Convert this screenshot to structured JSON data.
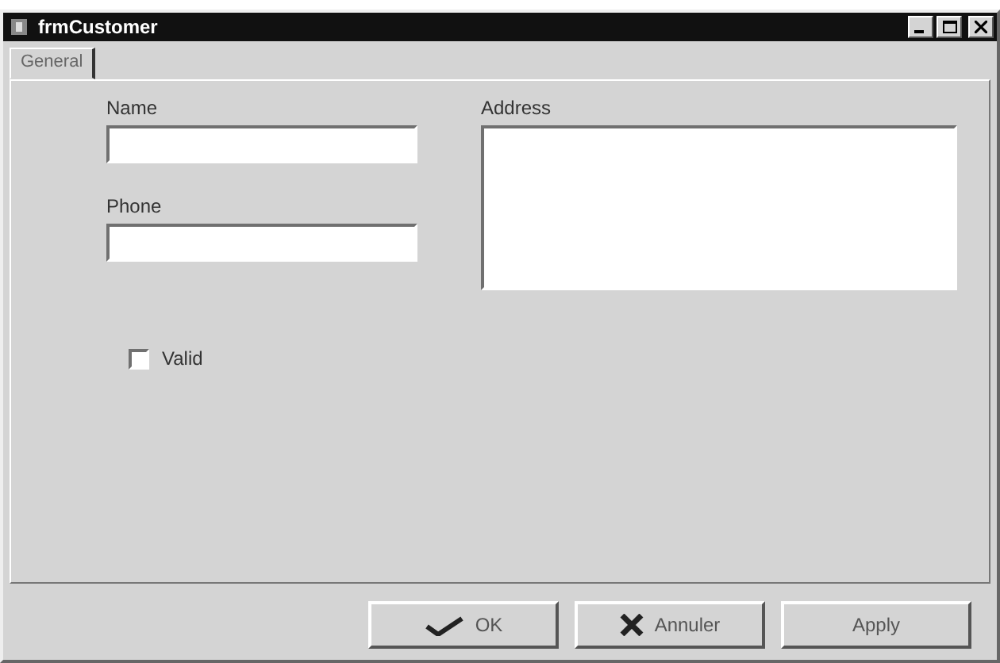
{
  "window": {
    "title": "frmCustomer"
  },
  "tabs": [
    {
      "label": "General",
      "selected": true
    }
  ],
  "fields": [
    {
      "label": "Name",
      "kind": "line"
    },
    {
      "label": "Phone",
      "kind": "line"
    },
    {
      "label": "Address",
      "kind": "multiline"
    }
  ],
  "checkbox": {
    "label": "Valid",
    "checked": false
  },
  "buttons": [
    {
      "label": "OK",
      "kind": "ok"
    },
    {
      "label": "Annuler",
      "kind": "cancel"
    },
    {
      "label": "Apply",
      "kind": "plain"
    }
  ]
}
